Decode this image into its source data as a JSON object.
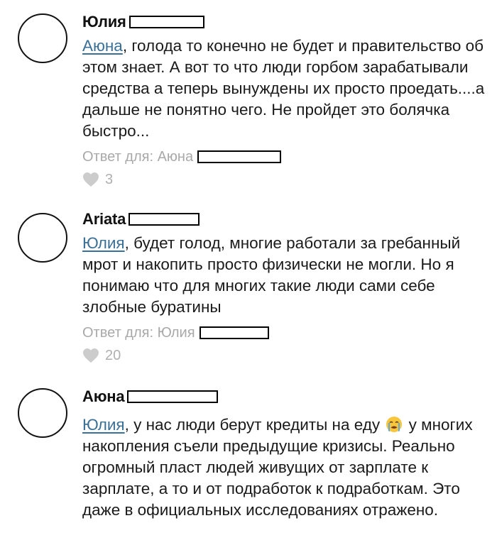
{
  "comments": [
    {
      "author": "Юлия",
      "mention": "Аюна",
      "text": ", голода то конечно не будет и правительство об этом знает. А вот то что люди горбом зарабатывали средства а теперь вынуждены их просто проедать....а дальше не понятно чего. Не пройдет это болячка быстро...",
      "reply_label": "Ответ для: Аюна",
      "likes": "3"
    },
    {
      "author": "Ariata",
      "mention": "Юлия",
      "text": ", будет голод, многие работали за гребанный мрот и накопить просто физически не могли. Но я понимаю что для многих такие люди сами себе злобные буратины",
      "reply_label": "Ответ для: Юлия",
      "likes": "20"
    },
    {
      "author": "Аюна",
      "mention": "Юлия",
      "text_before_emoji": ", у нас люди берут кредиты на еду",
      "emoji": "crying-face-emoji",
      "text_after_emoji": " у многих накопления съели предыдущие кризисы. Реально огромный пласт людей живущих от зарплате к зарплате, а то и от подработок к подработкам. Это даже в официальных исследованиях отражено."
    }
  ],
  "colors": {
    "mention": "#3a6f98",
    "muted": "#a9a9a9",
    "heart": "#cccccc",
    "emoji_face": "#f7c63d",
    "emoji_tears": "#5aa9e6"
  }
}
